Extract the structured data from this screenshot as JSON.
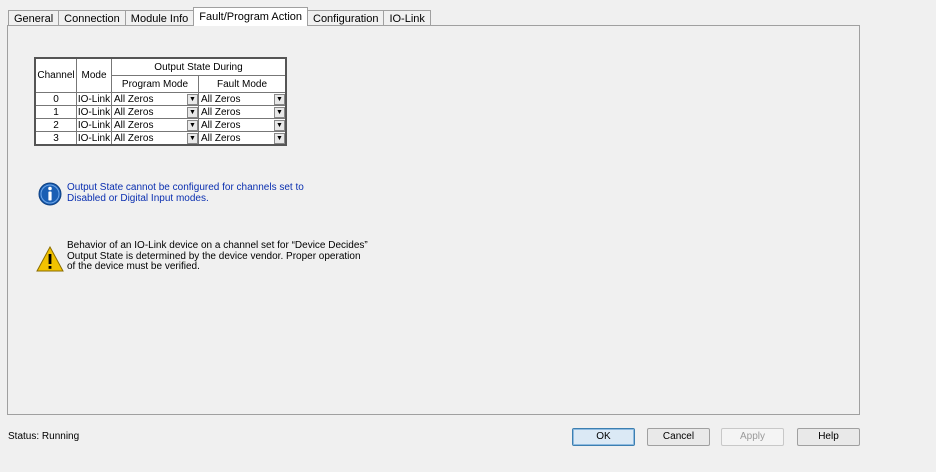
{
  "tabs": [
    {
      "label": "General"
    },
    {
      "label": "Connection"
    },
    {
      "label": "Module Info"
    },
    {
      "label": "Fault/Program Action"
    },
    {
      "label": "Configuration"
    },
    {
      "label": "IO-Link"
    }
  ],
  "table": {
    "header_channel": "Channel",
    "header_mode": "Mode",
    "header_group": "Output State During",
    "header_program": "Program Mode",
    "header_fault": "Fault Mode",
    "rows": [
      {
        "channel": "0",
        "mode": "IO-Link",
        "program": "All Zeros",
        "fault": "All Zeros"
      },
      {
        "channel": "1",
        "mode": "IO-Link",
        "program": "All Zeros",
        "fault": "All Zeros"
      },
      {
        "channel": "2",
        "mode": "IO-Link",
        "program": "All Zeros",
        "fault": "All Zeros"
      },
      {
        "channel": "3",
        "mode": "IO-Link",
        "program": "All Zeros",
        "fault": "All Zeros"
      }
    ]
  },
  "info": {
    "line1": "Output State cannot be configured for channels set to",
    "line2": "Disabled or Digital Input modes."
  },
  "warning": {
    "line1": "Behavior of an IO-Link device on a channel set for “Device Decides”",
    "line2": "Output State is determined by the device vendor.  Proper operation",
    "line3": "of the device must be verified."
  },
  "status": {
    "text": "Status:  Running"
  },
  "buttons": {
    "ok": "OK",
    "cancel": "Cancel",
    "apply": "Apply",
    "help": "Help"
  },
  "colors": {
    "info_text": "#0a2fb0",
    "info_icon": "#1a5fb4",
    "warning_icon": "#f2c200"
  }
}
